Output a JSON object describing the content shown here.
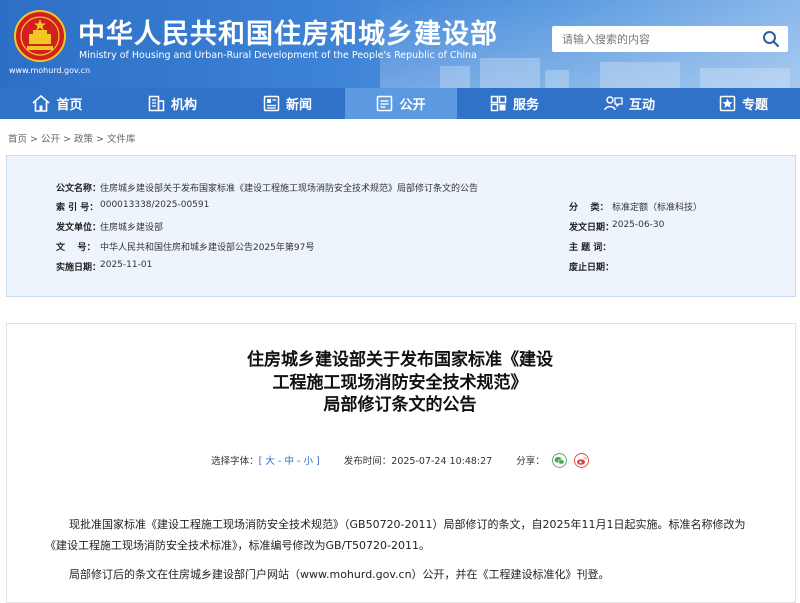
{
  "header": {
    "title": "中华人民共和国住房和城乡建设部",
    "subtitle": "Ministry of Housing and Urban-Rural Development of the People's Republic of China",
    "url": "www.mohurd.gov.cn",
    "search_placeholder": "请输入搜索的内容",
    "colors": {
      "banner": "#3c82d6",
      "nav": "#2f72c8",
      "nav_active": "#5b9ae0"
    }
  },
  "nav": {
    "items": [
      {
        "label": "首页",
        "icon": "home-icon"
      },
      {
        "label": "机构",
        "icon": "building-icon"
      },
      {
        "label": "新闻",
        "icon": "news-icon"
      },
      {
        "label": "公开",
        "icon": "open-icon",
        "active": true
      },
      {
        "label": "服务",
        "icon": "service-icon"
      },
      {
        "label": "互动",
        "icon": "interact-icon"
      },
      {
        "label": "专题",
        "icon": "topic-icon"
      }
    ]
  },
  "breadcrumb": [
    "首页",
    "公开",
    "政策",
    "文件库"
  ],
  "info": {
    "title_label": "公文名称：",
    "title_value": "住房城乡建设部关于发布国家标准《建设工程施工现场消防安全技术规范》局部修订条文的公告",
    "index_label": "索 引 号：",
    "index_value": "000013338/2025-00591",
    "category_label": "分    类：",
    "category_value": "标准定额（标准科技）",
    "issuer_label": "发文单位：",
    "issuer_value": "住房城乡建设部",
    "date_label": "发文日期：",
    "date_value": "2025-06-30",
    "docno_label": "文    号：",
    "docno_value": "中华人民共和国住房和城乡建设部公告2025年第97号",
    "subject_label": "主 题 词：",
    "subject_value": "",
    "effective_label": "实施日期：",
    "effective_value": "2025-11-01",
    "expiry_label": "废止日期：",
    "expiry_value": ""
  },
  "article": {
    "title_line1": "住房城乡建设部关于发布国家标准《建设",
    "title_line2": "工程施工现场消防安全技术规范》",
    "title_line3": "局部修订条文的公告",
    "font_label": "选择字体：",
    "font_open": "[",
    "font_large": "大",
    "font_medium": "中",
    "font_small": "小",
    "font_close": "]",
    "font_sep": "-",
    "publish_label": "发布时间：",
    "publish_time": "2025-07-24 10:48:27",
    "share_label": "分享：",
    "paragraph_1": "现批准国家标准《建设工程施工现场消防安全技术规范》（GB50720-2011）局部修订的条文，自2025年11月1日起实施。标准名称修改为《建设工程施工现场消防安全技术标准》，标准编号修改为GB/T50720-2011。",
    "paragraph_2": "局部修订后的条文在住房城乡建设部门户网站（www.mohurd.gov.cn）公开，并在《工程建设标准化》刊登。"
  }
}
